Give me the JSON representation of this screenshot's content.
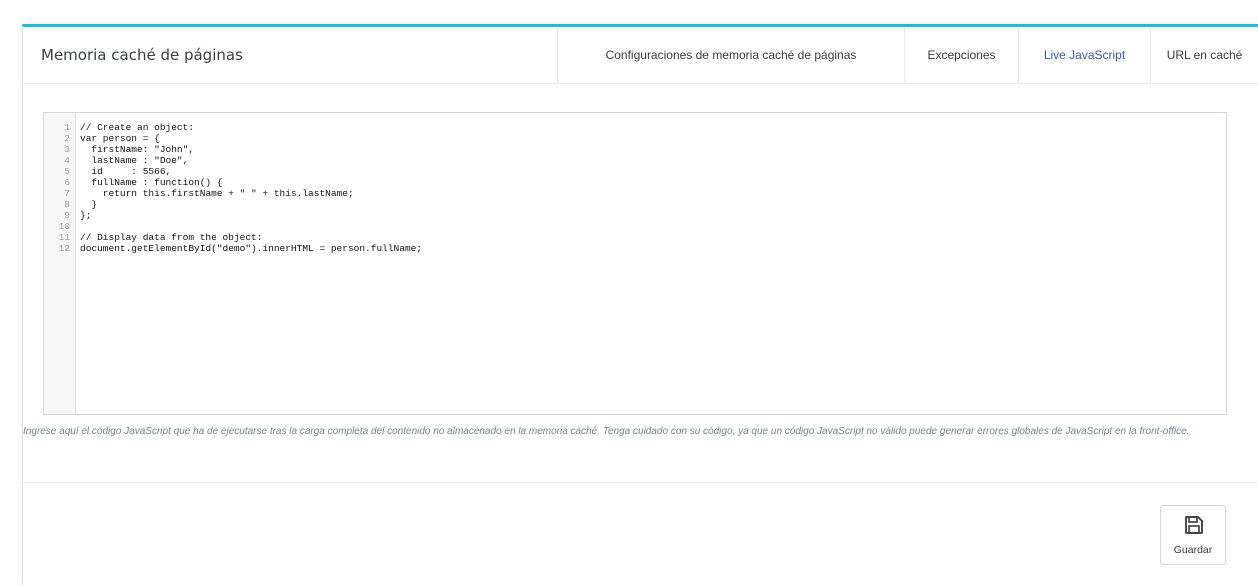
{
  "panel": {
    "title": "Memoria caché de páginas",
    "tabs": [
      {
        "label": "Configuraciones de memoria caché de páginas",
        "active": false
      },
      {
        "label": "Excepciones",
        "active": false
      },
      {
        "label": "Live JavaScript",
        "active": true
      },
      {
        "label": "URL en caché",
        "active": false
      }
    ]
  },
  "editor": {
    "lines": [
      {
        "num": "1",
        "text": "// Create an object:"
      },
      {
        "num": "2",
        "text": "var person = {"
      },
      {
        "num": "3",
        "text": "  firstName: \"John\","
      },
      {
        "num": "4",
        "text": "  lastName : \"Doe\","
      },
      {
        "num": "5",
        "text": "  id     : 5566,"
      },
      {
        "num": "6",
        "text": "  fullName : function() {"
      },
      {
        "num": "7",
        "text": "    return this.firstName + \" \" + this.lastName;"
      },
      {
        "num": "8",
        "text": "  }"
      },
      {
        "num": "9",
        "text": "};"
      },
      {
        "num": "10",
        "text": ""
      },
      {
        "num": "11",
        "text": "// Display data from the object:"
      },
      {
        "num": "12",
        "text": "document.getElementById(\"demo\").innerHTML = person.fullName;"
      }
    ]
  },
  "help_text": "Ingrese aquí el código JavaScript que ha de ejecutarse tras la carga completa del contenido no almacenado en la memoria caché. Tenga cuidado con su código, ya que un código JavaScript no válido puede generar errores globales de JavaScript en la front-office.",
  "save_button": {
    "label": "Guardar",
    "icon": "floppy-disk-icon"
  },
  "colors": {
    "accent_border": "#25b9d7",
    "active_tab": "#3a58a8",
    "help_text": "#6c868e"
  }
}
